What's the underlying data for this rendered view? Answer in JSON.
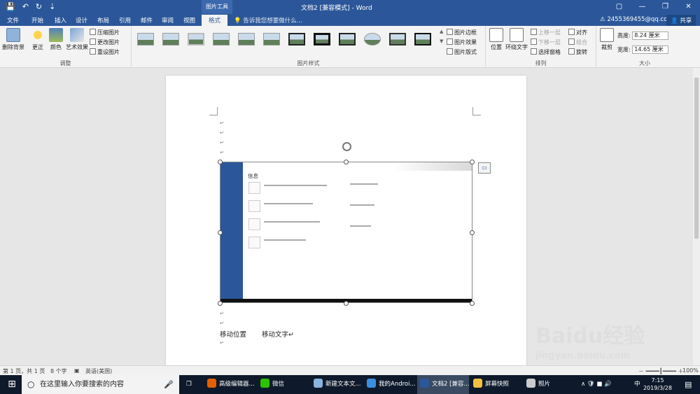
{
  "window": {
    "title": "文档2 [兼容模式] - Word",
    "context_tool": "图片工具",
    "controls": [
      "▢",
      "—",
      "❐",
      "✕"
    ]
  },
  "qat": [
    "💾",
    "↶",
    "↻",
    "⇣"
  ],
  "tabs": [
    "文件",
    "开始",
    "插入",
    "设计",
    "布局",
    "引用",
    "邮件",
    "审阅",
    "视图",
    "格式"
  ],
  "tell_me": "告诉我您想要做什么...",
  "account": "2455369455@qq.com",
  "share": "共享",
  "ribbon": {
    "adjust": {
      "label": "调整",
      "remove_bg": "删除背景",
      "correct": "更正",
      "color": "颜色",
      "art": "艺术效果",
      "compress": "压缩图片",
      "change": "更改图片",
      "reset": "重设图片"
    },
    "styles": {
      "label": "图片样式",
      "border": "图片边框",
      "effect": "图片效果",
      "layout": "图片版式"
    },
    "arrange": {
      "label": "排列",
      "position": "位置",
      "wrap": "环绕文字",
      "forward": "上移一层",
      "backward": "下移一层",
      "pane": "选择窗格",
      "align": "对齐",
      "group": "组合",
      "rotate": "旋转"
    },
    "size": {
      "label": "大小",
      "crop": "裁剪",
      "height_label": "高度:",
      "height": "8.24 厘米",
      "width_label": "宽度:",
      "width": "14.65 厘米"
    }
  },
  "document": {
    "para_mark": "↵",
    "screenshot_heading": "信息",
    "text1": "移动位置",
    "text2": "移动文字↵"
  },
  "status": {
    "page": "第 1 页，共 1 页",
    "words": "8 个字",
    "lang": "英语(美国)",
    "zoom": "100%"
  },
  "taskbar": {
    "search": "在这里输入你要搜索的内容",
    "items": [
      "高级编辑器...",
      "微信",
      "新建文本文...",
      "我的Androi...",
      "文档2 [兼容...",
      "屏幕快照",
      "照片"
    ],
    "time": "7:15",
    "date": "2019/3/28",
    "ime": "中",
    "tray": "∧ 🛡 ■ 🔊"
  },
  "watermark": {
    "brand": "Baidu经验",
    "url": "jingyan.baidu.com"
  }
}
